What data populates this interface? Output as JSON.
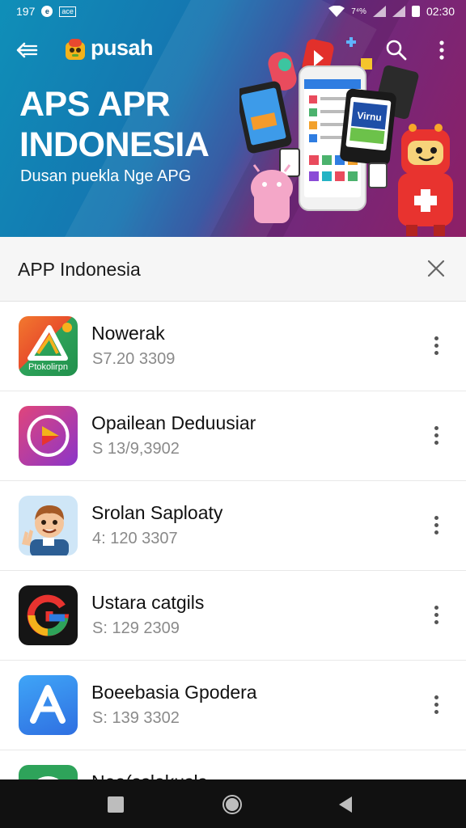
{
  "status_bar": {
    "left_text": "197",
    "left_chip": "ace",
    "battery_pct": "7⁴%",
    "time": "02:30"
  },
  "toolbar": {
    "title": "pusah",
    "icons": [
      "back-arrow-icon",
      "app-logo-icon",
      "search-icon",
      "more-vert-icon"
    ]
  },
  "hero": {
    "title_line1": "APS APR",
    "title_line2": "INDONESIA",
    "subtitle": "Dusan puekla Nge APG",
    "phone_card_text": "Virnu"
  },
  "sheet": {
    "title": "APP Indonesia",
    "close_icon": "close-icon"
  },
  "apps": [
    {
      "name": "Nowerak",
      "meta": "S7.20 3309",
      "icon": "orange-green-triangle-icon",
      "icon_label": "Ptokolirpn"
    },
    {
      "name": "Opailean Deduusiar",
      "meta": "S 13/9,3902",
      "icon": "play-button-icon",
      "icon_label": ""
    },
    {
      "name": "Srolan Saploaty",
      "meta": "4: 120 3307",
      "icon": "cartoon-face-icon",
      "icon_label": ""
    },
    {
      "name": "Ustara catgils",
      "meta": "S: 129 2309",
      "icon": "g-letter-icon",
      "icon_label": ""
    },
    {
      "name": "Boeebasia Gpodera",
      "meta": "S: 139 3302",
      "icon": "a-letter-icon",
      "icon_label": ""
    },
    {
      "name": "Nee(sslakusls",
      "meta": "",
      "icon": "green-app-icon",
      "icon_label": ""
    }
  ],
  "nav": {
    "icons": [
      "recents-square-icon",
      "home-circle-icon",
      "back-triangle-icon"
    ]
  },
  "colors": {
    "hero_start": "#0f8fb8",
    "hero_end": "#8e1f66",
    "sheet_bg": "#f6f6f6",
    "nav_bg": "#111111"
  }
}
